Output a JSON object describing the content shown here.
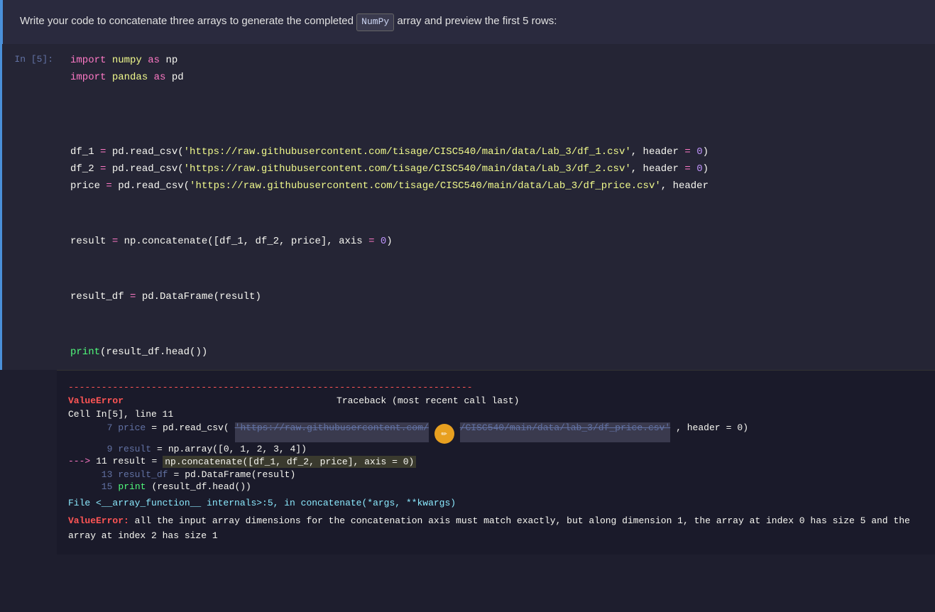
{
  "instruction": {
    "text_before": "Write your code to concatenate three arrays to generate the completed ",
    "badge": "NumPy",
    "text_after": " array and preview the first 5 rows:"
  },
  "cell": {
    "label": "In [5]:",
    "lines": [
      {
        "type": "import",
        "content": "import numpy as np"
      },
      {
        "type": "import",
        "content": "import pandas as pd"
      },
      {
        "type": "empty"
      },
      {
        "type": "empty"
      },
      {
        "type": "empty"
      },
      {
        "type": "read_csv1",
        "content": "df_1 = pd.read_csv('https://raw.githubusercontent.com/tisage/CISC540/main/data/Lab_3/df_1.csv', header = 0)"
      },
      {
        "type": "read_csv2",
        "content": "df_2 = pd.read_csv('https://raw.githubusercontent.com/tisage/CISC540/main/data/Lab_3/df_2.csv', header = 0)"
      },
      {
        "type": "read_csv3",
        "content": "price = pd.read_csv('https://raw.githubusercontent.com/tisage/CISC540/main/data/Lab_3/df_price.csv', header"
      },
      {
        "type": "empty"
      },
      {
        "type": "empty"
      },
      {
        "type": "concat",
        "content": "result = np.concatenate([df_1, df_2, price], axis = 0)"
      },
      {
        "type": "empty"
      },
      {
        "type": "empty"
      },
      {
        "type": "dataframe",
        "content": "result_df = pd.DataFrame(result)"
      },
      {
        "type": "empty"
      },
      {
        "type": "empty"
      },
      {
        "type": "print",
        "content": "print(result_df.head())"
      }
    ]
  },
  "output": {
    "separator": "-------------------------------------------------------------------------",
    "error_type": "ValueError",
    "traceback_header": "Traceback (most recent call last)",
    "cell_info": "Cell In[5], line 11",
    "traceback_lines": [
      {
        "num": "7",
        "code": "price = pd.read_csv('https://raw.githubusercontent.com/...CISC540/main/data/lab_3/df_price.csv', header = 0)"
      },
      {
        "num": "9",
        "code": "result = np.array([0, 1, 2, 3, 4])"
      },
      {
        "arrow": true,
        "num": "11",
        "code": "result = np.concatenate([df_1, df_2, price], axis = 0)"
      },
      {
        "num": "13",
        "code": "result_df = pd.DataFrame(result)"
      },
      {
        "num": "15",
        "code": "print(result_df.head())"
      }
    ],
    "file_line": "File <__array_function__ internals>:5, in concatenate(*args, **kwargs)",
    "error_message": "ValueError: all the input array dimensions for the concatenation axis must match exactly, but along dimension 1, the array at index 0 has size 5 and the array at index 2 has size 1"
  }
}
